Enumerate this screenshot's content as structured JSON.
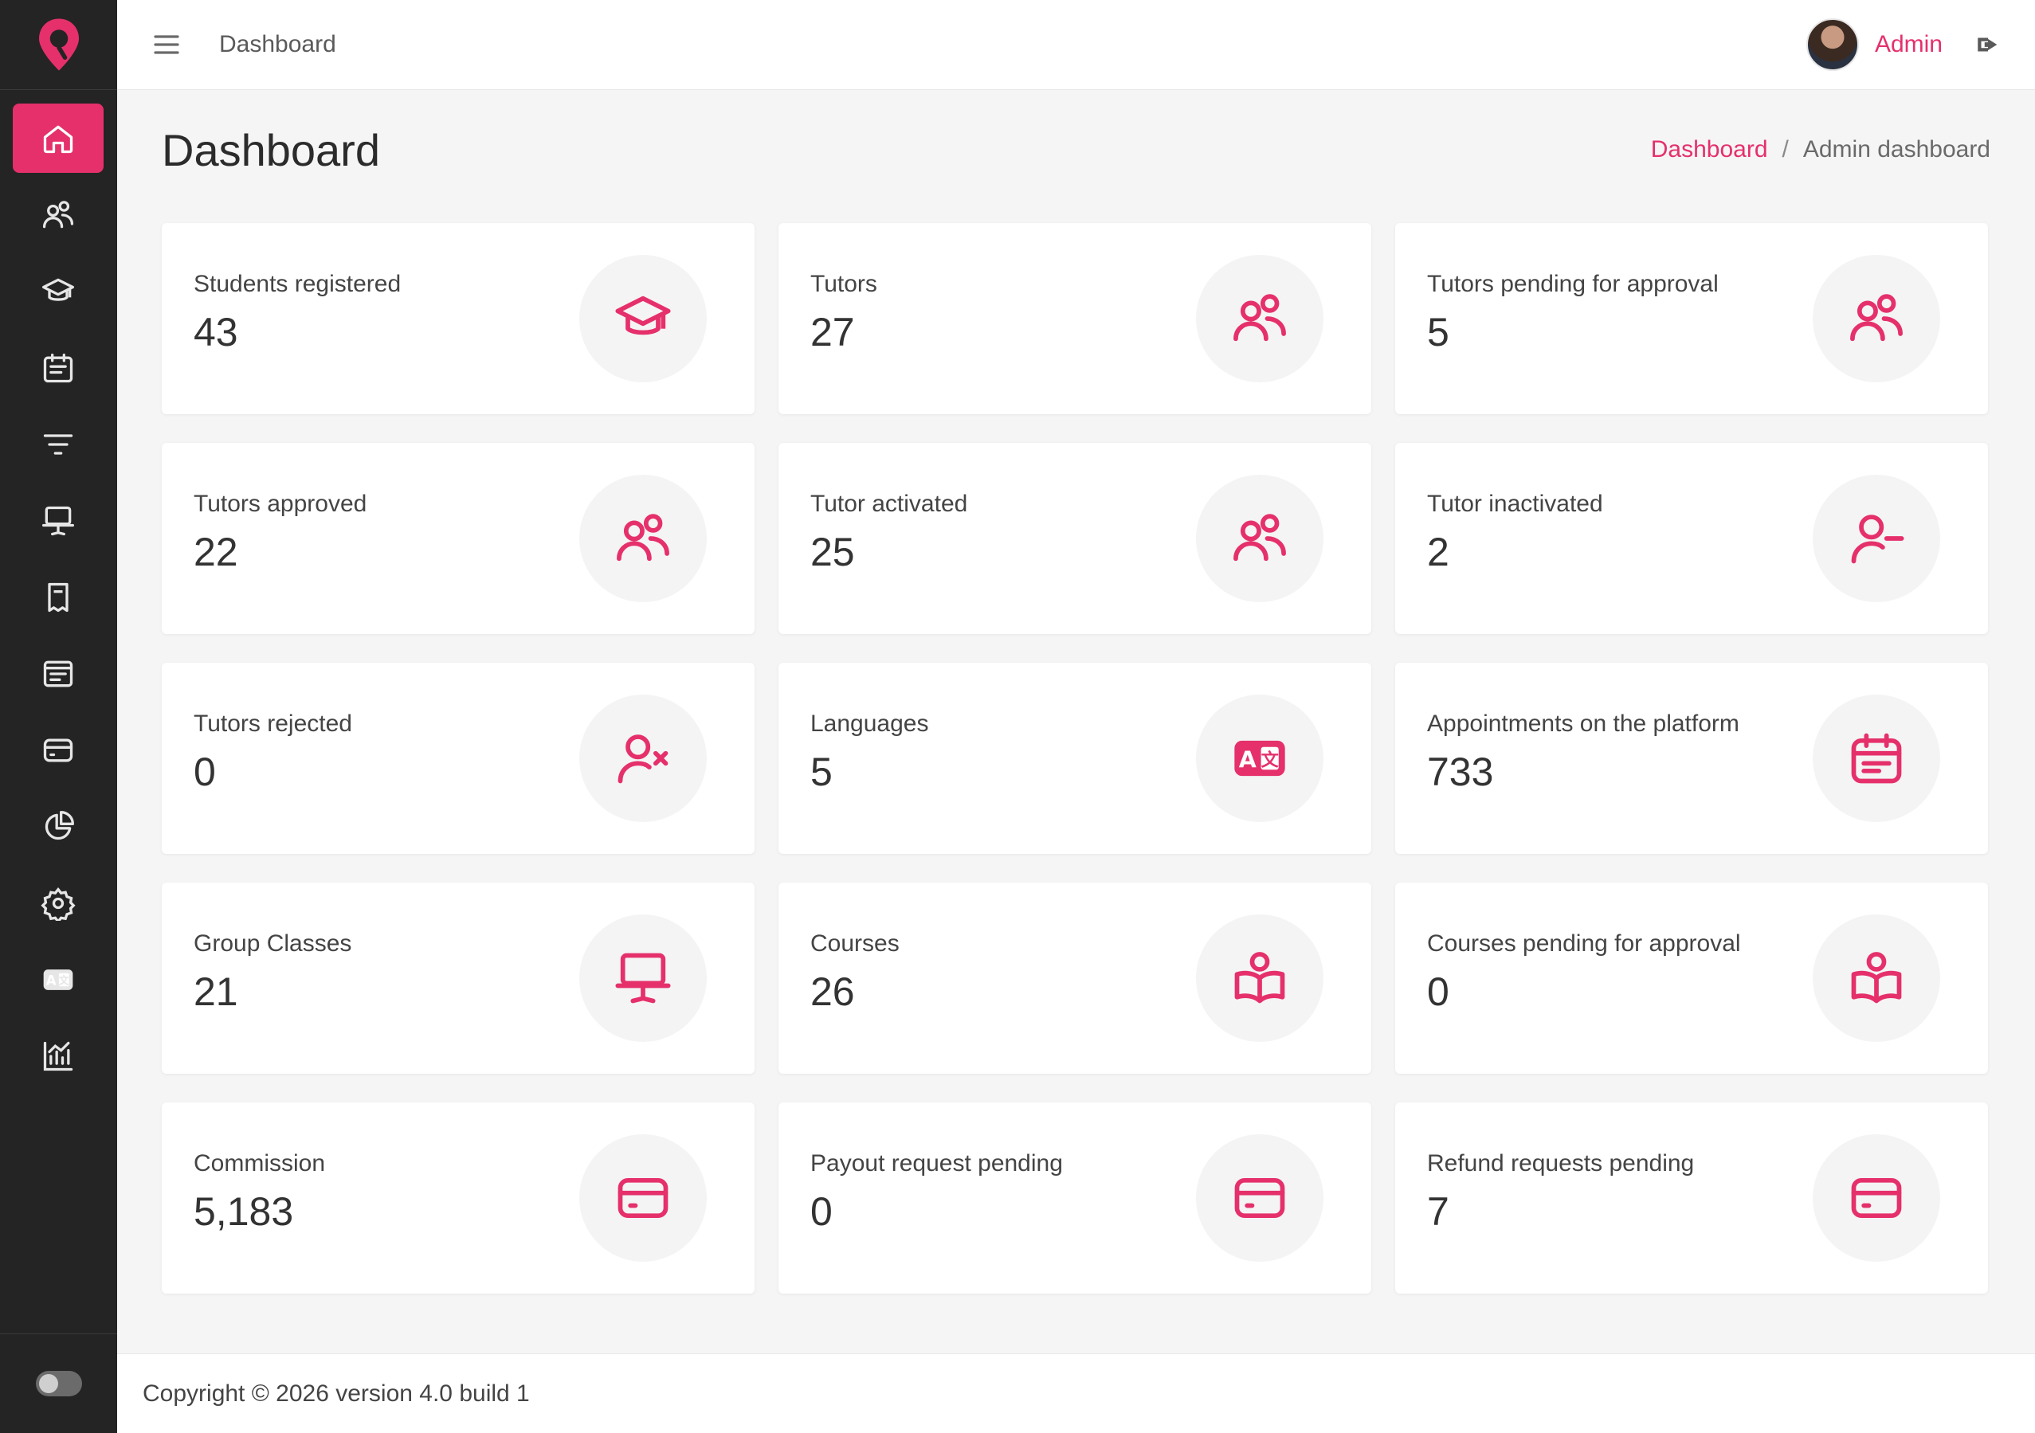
{
  "colors": {
    "accent": "#e5306b",
    "sidebar_bg": "#242424",
    "page_bg": "#f5f5f5"
  },
  "sidebar": {
    "logo": "brand-logo-icon",
    "items": [
      {
        "icon": "home-icon",
        "active": true
      },
      {
        "icon": "users-icon"
      },
      {
        "icon": "graduation-cap-icon"
      },
      {
        "icon": "calendar-list-icon"
      },
      {
        "icon": "filter-icon"
      },
      {
        "icon": "presentation-icon"
      },
      {
        "icon": "bookmark-icon"
      },
      {
        "icon": "news-icon"
      },
      {
        "icon": "credit-card-icon"
      },
      {
        "icon": "pie-chart-icon"
      },
      {
        "icon": "settings-icon"
      },
      {
        "icon": "language-icon"
      },
      {
        "icon": "bar-chart-icon"
      }
    ],
    "theme_toggle": "theme-toggle"
  },
  "header": {
    "title": "Dashboard",
    "user_name": "Admin"
  },
  "page": {
    "title": "Dashboard",
    "breadcrumb": {
      "link": "Dashboard",
      "separator": "/",
      "current": "Admin dashboard"
    }
  },
  "cards": [
    {
      "label": "Students registered",
      "value": "43",
      "icon": "graduation-cap-icon"
    },
    {
      "label": "Tutors",
      "value": "27",
      "icon": "users-icon"
    },
    {
      "label": "Tutors pending for approval",
      "value": "5",
      "icon": "users-icon"
    },
    {
      "label": "Tutors approved",
      "value": "22",
      "icon": "users-icon"
    },
    {
      "label": "Tutor activated",
      "value": "25",
      "icon": "users-icon"
    },
    {
      "label": "Tutor inactivated",
      "value": "2",
      "icon": "user-minus-icon"
    },
    {
      "label": "Tutors rejected",
      "value": "0",
      "icon": "user-x-icon"
    },
    {
      "label": "Languages",
      "value": "5",
      "icon": "language-icon"
    },
    {
      "label": "Appointments on the platform",
      "value": "733",
      "icon": "calendar-icon"
    },
    {
      "label": "Group Classes",
      "value": "21",
      "icon": "presentation-icon"
    },
    {
      "label": "Courses",
      "value": "26",
      "icon": "book-reader-icon"
    },
    {
      "label": "Courses pending for approval",
      "value": "0",
      "icon": "book-reader-icon"
    },
    {
      "label": "Commission",
      "value": "5,183",
      "icon": "credit-card-icon"
    },
    {
      "label": "Payout request pending",
      "value": "0",
      "icon": "credit-card-icon"
    },
    {
      "label": "Refund requests pending",
      "value": "7",
      "icon": "credit-card-icon"
    }
  ],
  "footer": {
    "copyright": "Copyright © 2026 version 4.0 build 1"
  }
}
